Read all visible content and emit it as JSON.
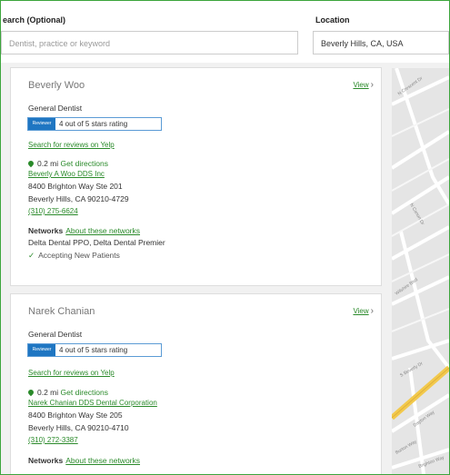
{
  "search": {
    "keyword_label": "earch (Optional)",
    "keyword_placeholder": "Dentist, practice or keyword",
    "location_label": "Location",
    "location_value": "Beverly Hills, CA, USA"
  },
  "results": [
    {
      "name": "Beverly Woo",
      "view_label": "View",
      "specialty": "General Dentist",
      "rating_badge": "Reviewer",
      "rating_text": "4 out of 5 stars rating",
      "search_reviews": "Search for reviews on Yelp",
      "distance": "0.2 mi",
      "directions": "Get directions",
      "practice": "Beverly A Woo DDS Inc",
      "address1": "8400 Brighton Way Ste 201",
      "address2": "Beverly Hills, CA 90210-4729",
      "phone": "(310) 275-6624",
      "networks_label": "Networks",
      "about_networks": "About these networks",
      "networks_value": "Delta Dental PPO, Delta Dental Premier",
      "accepting": "Accepting New Patients"
    },
    {
      "name": "Narek Chanian",
      "view_label": "View",
      "specialty": "General Dentist",
      "rating_badge": "Reviewer",
      "rating_text": "4 out of 5 stars rating",
      "search_reviews": "Search for reviews on Yelp",
      "distance": "0.2 mi",
      "directions": "Get directions",
      "practice": "Narek Chanian DDS Dental Corporation",
      "address1": "8400 Brighton Way Ste 205",
      "address2": "Beverly Hills, CA 90210-4710",
      "phone": "(310) 272-3387",
      "networks_label": "Networks",
      "about_networks": "About these networks"
    }
  ],
  "map": {
    "streets": [
      "N Crescent Dr",
      "N Canon Dr",
      "Wilshire Blvd",
      "S Beverly Dr",
      "Dayton Way",
      "Burton Way",
      "Brighton Way"
    ]
  },
  "colors": {
    "accent_green": "#2a8a2a",
    "rating_blue": "#1f76c2",
    "frame_green": "#3ca53c"
  }
}
